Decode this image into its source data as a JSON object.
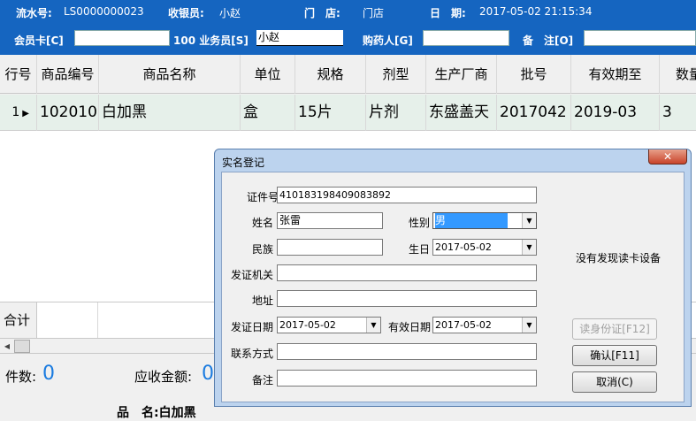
{
  "header": {
    "serial_label": "流水号:",
    "serial_value": "LS0000000023",
    "cashier_label": "收银员:",
    "cashier_value": "小赵",
    "store_label": "门　店:",
    "store_value": "门店",
    "date_label": "日　期:",
    "date_value": "2017-05-02  21:15:34",
    "member_label": "会员卡[C]",
    "member_value": "",
    "salesman_label": "100 业务员[S]",
    "salesman_value": "小赵",
    "buyer_label": "购药人[G]",
    "buyer_value": "",
    "remark_label": "备　注[O]",
    "remark_value": ""
  },
  "table": {
    "columns": [
      "行号",
      "商品编号",
      "商品名称",
      "单位",
      "规格",
      "剂型",
      "生产厂商",
      "批号",
      "有效期至",
      "数量"
    ],
    "rows": [
      {
        "row_no": "1",
        "code": "102010",
        "name": "白加黑",
        "unit": "盒",
        "spec": "15片",
        "form": "片剂",
        "maker": "东盛盖天",
        "batch": "2017042",
        "expiry": "2019-03",
        "qty": "3"
      }
    ],
    "sum_label": "合计"
  },
  "footer": {
    "count_label": "件数:",
    "count_value": "0",
    "due_label": "应收金额:",
    "due_value": "0",
    "partial_bottom_text": "品　名:白加黑"
  },
  "dialog": {
    "title": "实名登记",
    "close_icon": "close-icon",
    "fields": {
      "id_label": "证件号",
      "id_value": "410183198409083892",
      "name_label": "姓名",
      "name_value": "张雷",
      "gender_label": "性别",
      "gender_value": "男",
      "ethnic_label": "民族",
      "ethnic_value": "",
      "birth_label": "生日",
      "birth_value": "2017-05-02",
      "issuer_label": "发证机关",
      "issuer_value": "",
      "address_label": "地址",
      "address_value": "",
      "issue_date_label": "发证日期",
      "issue_date_value": "2017-05-02",
      "valid_date_label": "有效日期",
      "valid_date_value": "2017-05-02",
      "contact_label": "联系方式",
      "contact_value": "",
      "note_label": "备注",
      "note_value": ""
    },
    "device_status": "没有发现读卡设备",
    "read_id_button": "读身份证[F12]",
    "confirm_button": "确认[F11]",
    "cancel_button": "取消(C)"
  },
  "colors": {
    "header_bg": "#1565c0",
    "row_bg": "#e6f0ea",
    "count_color": "#1a7be0"
  }
}
